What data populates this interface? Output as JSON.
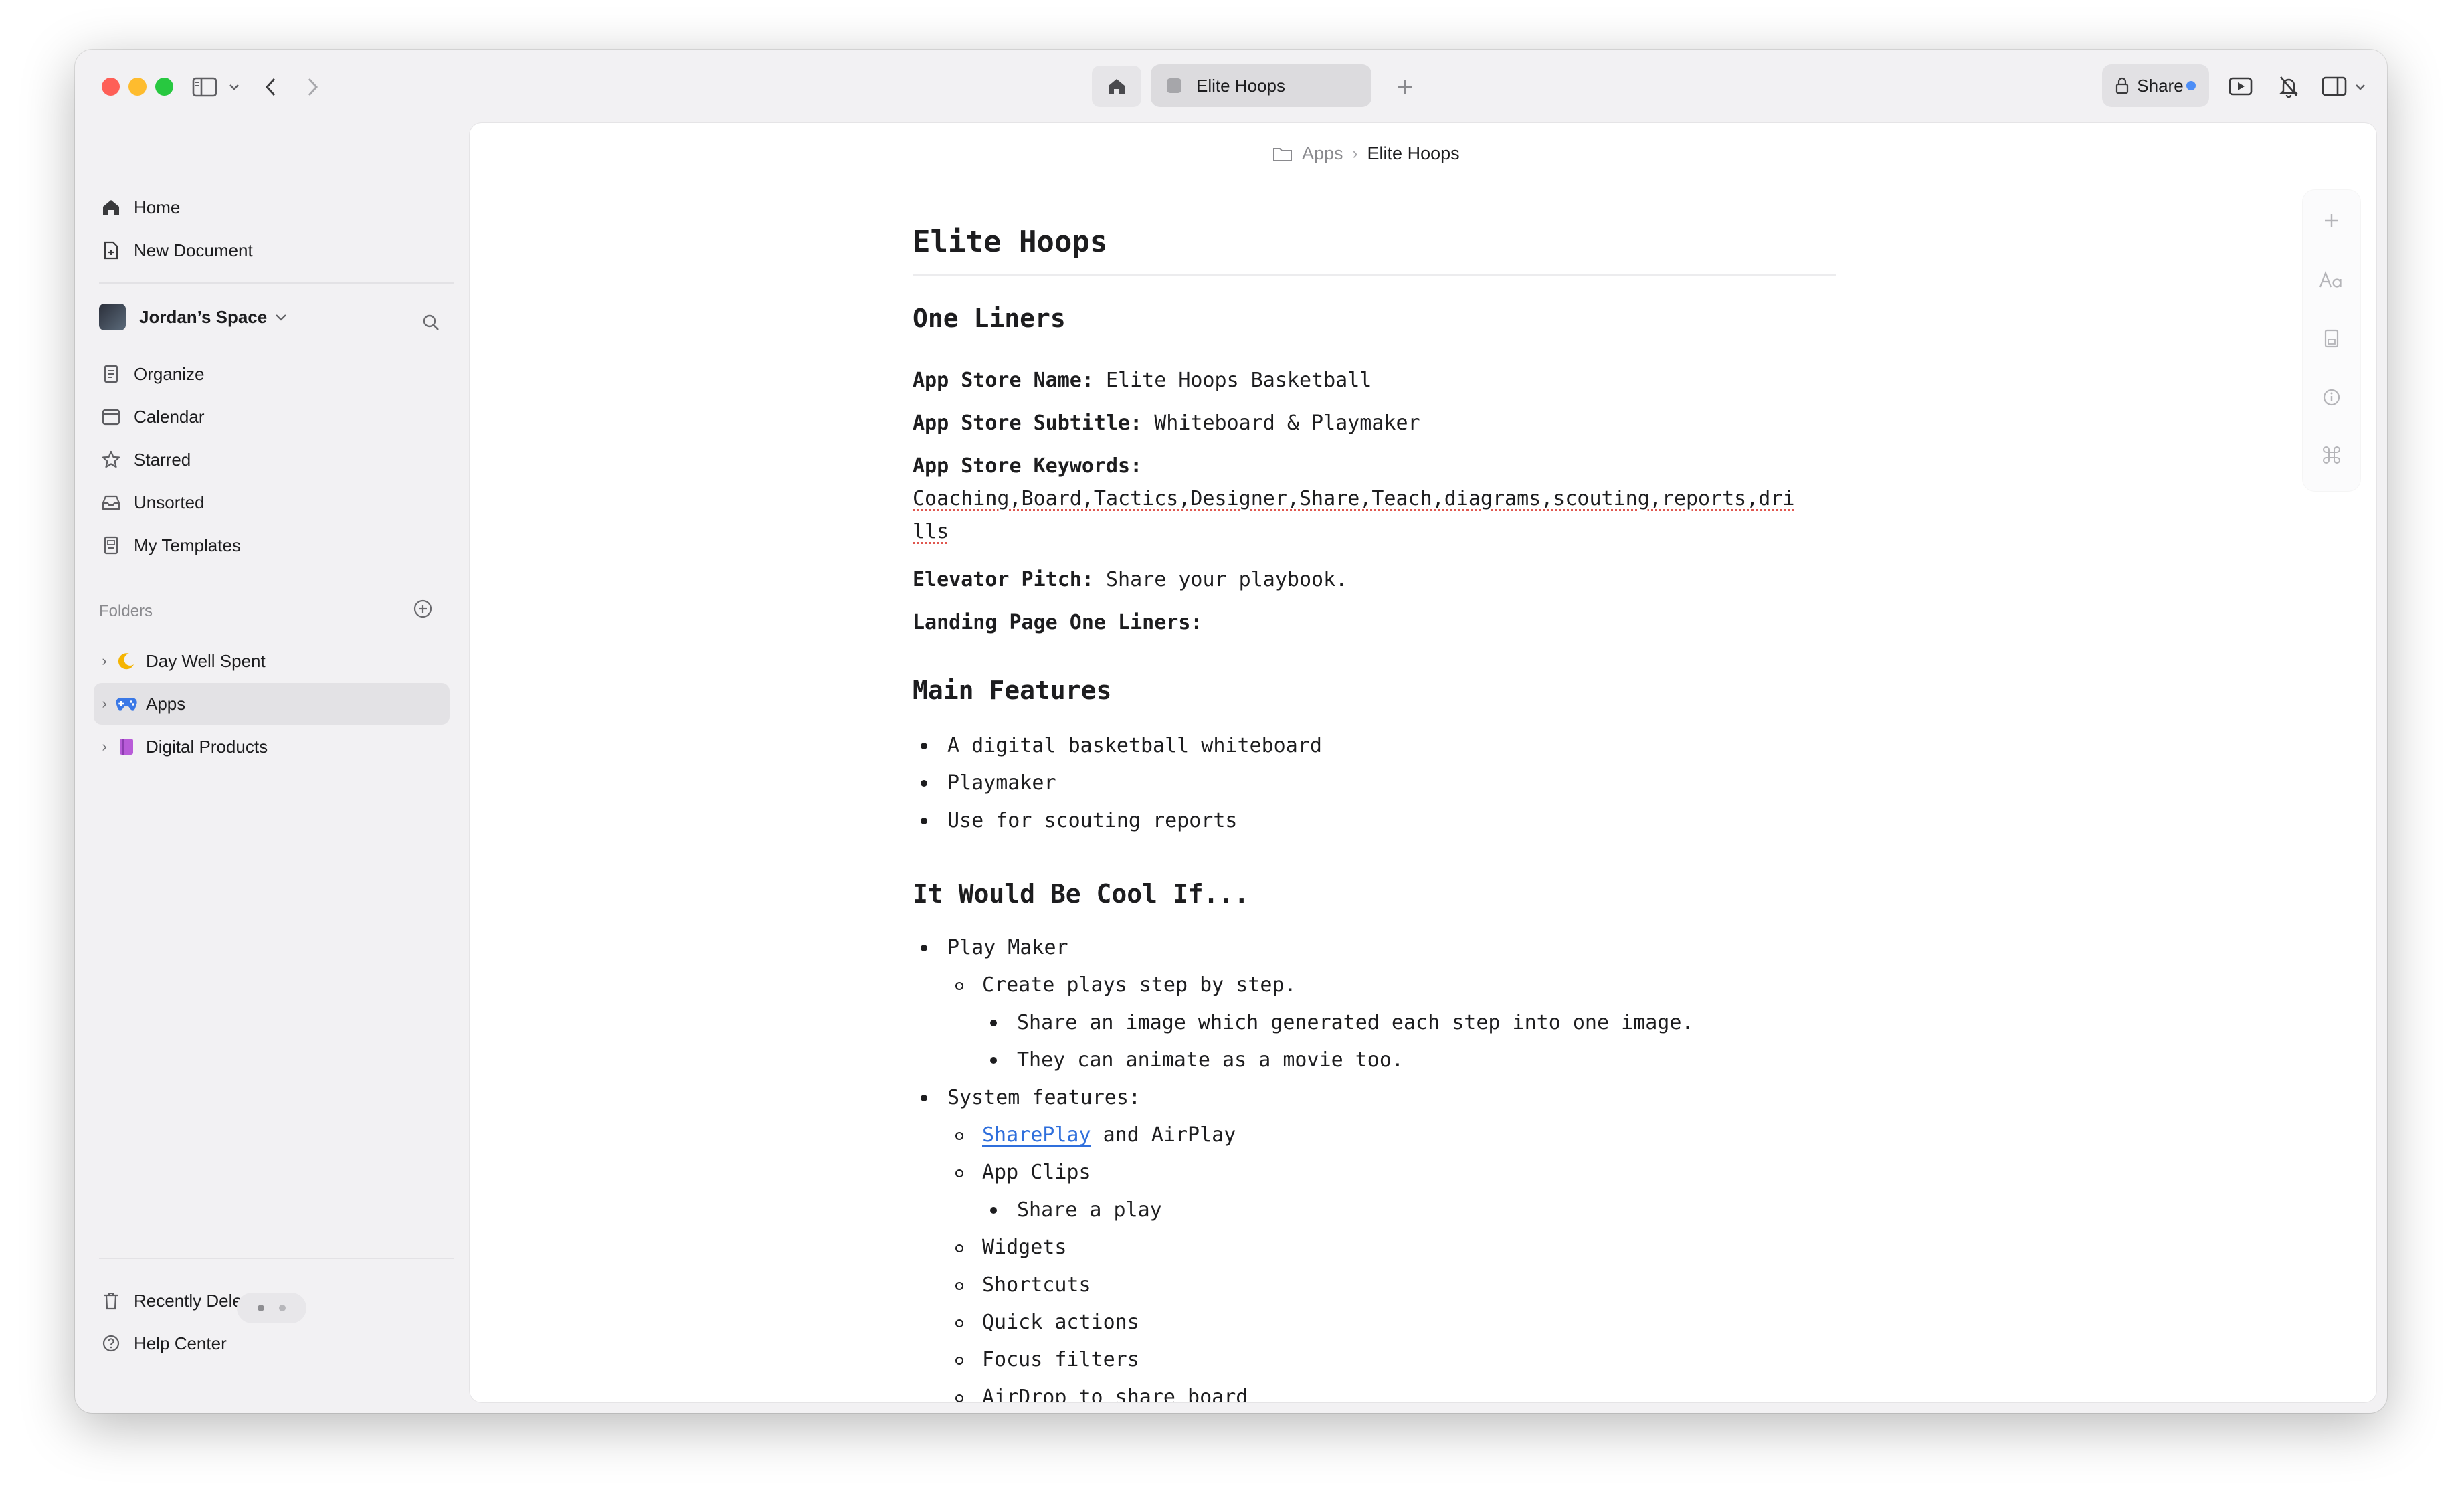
{
  "window": {
    "tab_title": "Elite Hoops",
    "share_label": "Share"
  },
  "sidebar": {
    "home": "Home",
    "new_document": "New Document",
    "space_name": "Jordan’s Space",
    "nav": [
      "Organize",
      "Calendar",
      "Starred",
      "Unsorted",
      "My Templates"
    ],
    "folders_label": "Folders",
    "folders": [
      {
        "label": "Day Well Spent",
        "icon": "moon-icon",
        "color": "#f5b400"
      },
      {
        "label": "Apps",
        "icon": "gamepad-icon",
        "color": "#3a78e6"
      },
      {
        "label": "Digital Products",
        "icon": "notebook-icon",
        "color": "#b85bd8"
      }
    ],
    "recently_deleted": "Recently Deleted",
    "help_center": "Help Center"
  },
  "breadcrumb": {
    "parent": "Apps",
    "current": "Elite Hoops"
  },
  "document": {
    "title": "Elite Hoops",
    "one_liners_heading": "One Liners",
    "app_store_name_label": "App Store Name:",
    "app_store_name_value": " Elite Hoops Basketball",
    "app_store_subtitle_label": "App Store Subtitle:",
    "app_store_subtitle_value": " Whiteboard & Playmaker",
    "app_store_keywords_label": "App Store Keywords:",
    "keywords_line1": "Coaching,Board,Tactics,Designer,Share,Teach,diagrams,scouting,reports,dri",
    "keywords_line2": "lls",
    "elevator_pitch_label": "Elevator Pitch:",
    "elevator_pitch_value": " Share your playbook.",
    "landing_page_label": "Landing Page One Liners:",
    "main_features_heading": "Main Features",
    "main_features": [
      "A digital basketball whiteboard",
      "Playmaker",
      "Use for scouting reports"
    ],
    "cool_heading": "It Would Be Cool If...",
    "cool_items": {
      "play_maker": "Play Maker",
      "create_plays": "Create plays step by step.",
      "share_image": "Share an image which generated each step into one image.",
      "animate": "They can animate as a movie too.",
      "system_features": "System features:",
      "shareplay_link": "SharePlay",
      "and_airplay": " and AirPlay",
      "app_clips": "App Clips",
      "share_a_play": "Share a play",
      "widgets": "Widgets",
      "shortcuts": "Shortcuts",
      "quick_actions": "Quick actions",
      "focus_filters": "Focus filters",
      "airdrop": "AirDrop to share board"
    }
  }
}
